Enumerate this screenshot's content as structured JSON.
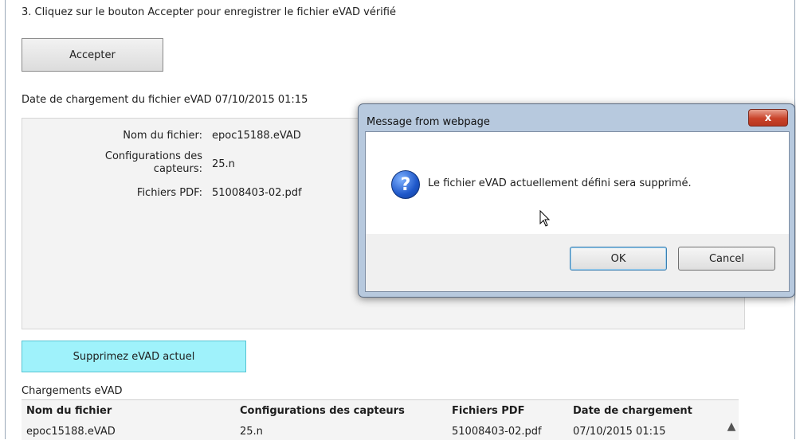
{
  "page": {
    "step_text": "3. Cliquez sur le bouton Accepter pour enregistrer le fichier eVAD vérifié",
    "accept_button": "Accepter",
    "load_date_text": "Date de chargement du fichier eVAD 07/10/2015 01:15",
    "file_info": {
      "name_label": "Nom du fichier:",
      "name_value": "epoc15188.eVAD",
      "config_label_line1": "Configurations des",
      "config_label_line2": "capteurs:",
      "config_value": "25.n",
      "pdf_label": "Fichiers PDF:",
      "pdf_value": "51008403-02.pdf"
    },
    "delete_button": "Supprimez eVAD actuel",
    "uploads_title": "Chargements eVAD",
    "table": {
      "headers": [
        "Nom du fichier",
        "Configurations des capteurs",
        "Fichiers PDF",
        "Date de chargement"
      ],
      "rows": [
        [
          "epoc15188.eVAD",
          "25.n",
          "51008403-02.pdf",
          "07/10/2015 01:15"
        ]
      ]
    }
  },
  "dialog": {
    "title": "Message from webpage",
    "close_label": "x",
    "message": "Le fichier eVAD actuellement défini sera supprimé.",
    "icon": "question-icon",
    "ok_label": "OK",
    "cancel_label": "Cancel"
  },
  "colors": {
    "delete_button_bg": "#9ff2fb",
    "close_button": "#c9432a",
    "dialog_frame": "#b7c9de"
  }
}
